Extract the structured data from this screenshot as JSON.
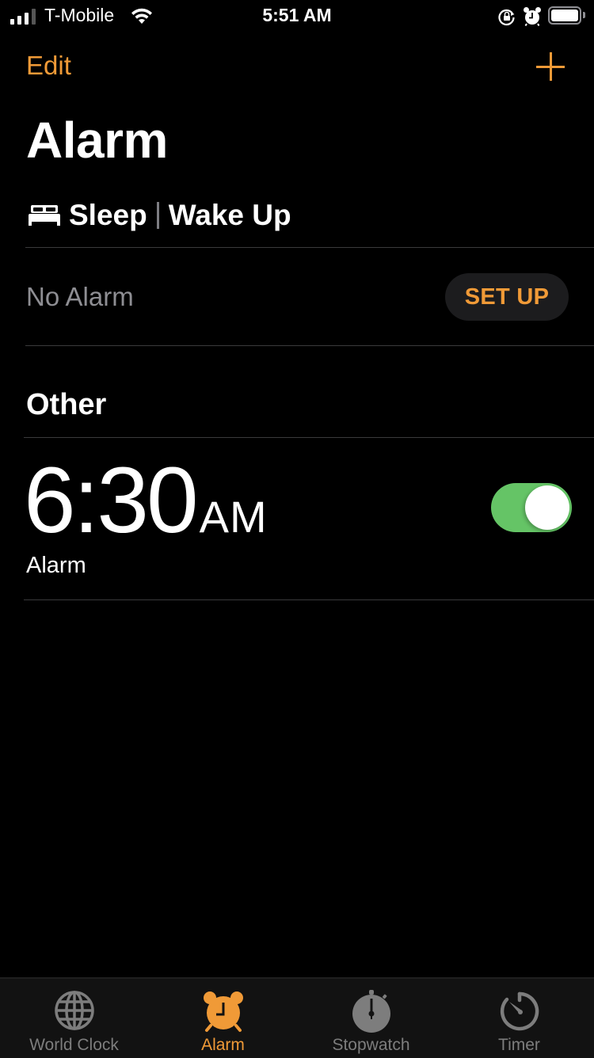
{
  "status_bar": {
    "carrier": "T-Mobile",
    "time": "5:51 AM",
    "signal_bars": 3,
    "signal_bars_total": 4,
    "icons": [
      "signal-icon",
      "wifi-icon",
      "rotation-lock-icon",
      "alarm-icon",
      "battery-icon"
    ]
  },
  "nav": {
    "edit_label": "Edit",
    "add_icon": "plus-icon"
  },
  "page": {
    "title": "Alarm"
  },
  "sleep": {
    "icon": "bed-icon",
    "sleep_label": "Sleep",
    "wake_label": "Wake Up",
    "status": "No Alarm",
    "setup_label": "SET UP"
  },
  "other": {
    "header": "Other",
    "alarms": [
      {
        "hour_min": "6:30",
        "ampm": "AM",
        "label": "Alarm",
        "enabled": true
      }
    ]
  },
  "tab_bar": {
    "tabs": [
      {
        "label": "World Clock",
        "icon": "globe-icon",
        "active": false
      },
      {
        "label": "Alarm",
        "icon": "alarm-clock-icon",
        "active": true
      },
      {
        "label": "Stopwatch",
        "icon": "stopwatch-icon",
        "active": false
      },
      {
        "label": "Timer",
        "icon": "timer-icon",
        "active": false
      }
    ]
  },
  "colors": {
    "accent": "#f09a37",
    "toggle_on": "#65c466",
    "inactive_tab": "#7d7d7d",
    "secondary_text": "#8e8e93"
  }
}
